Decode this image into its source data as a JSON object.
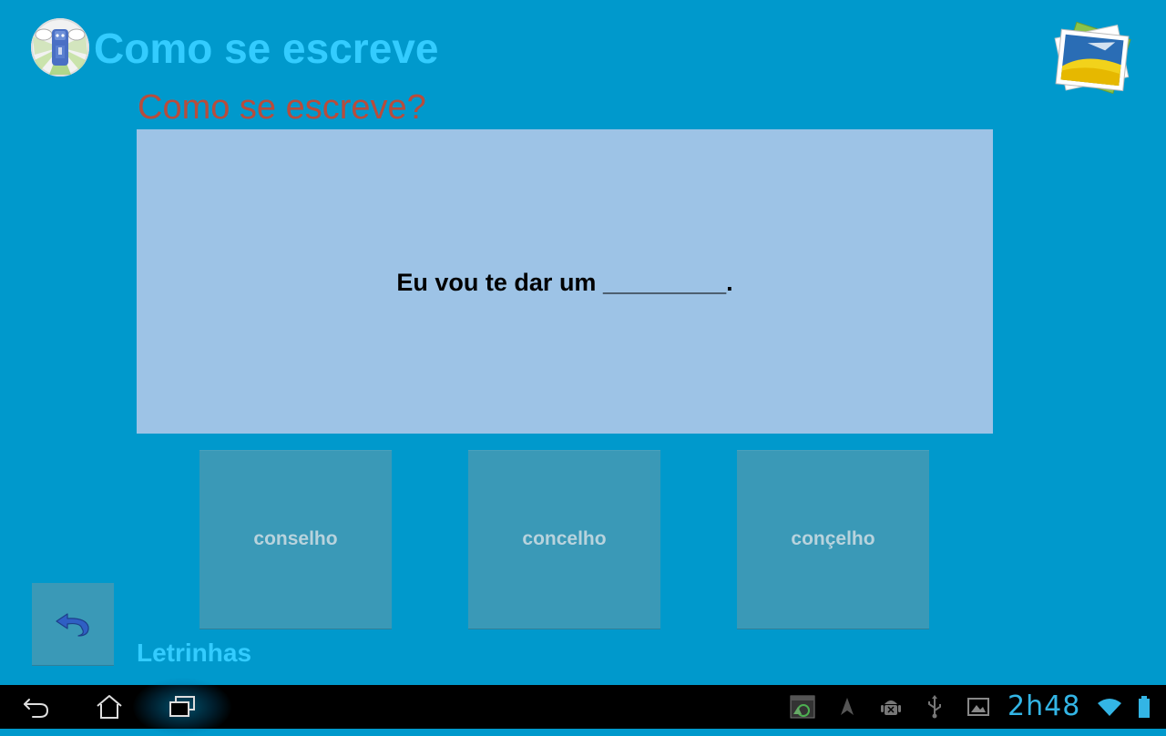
{
  "header": {
    "app_title": "Como se escreve",
    "logo_icon": "mascot-logo-icon",
    "action_icon": "photo-gallery-icon"
  },
  "question": {
    "heading": "Como se escreve?",
    "sentence": "Eu vou te dar um _________."
  },
  "options": [
    {
      "label": "conselho"
    },
    {
      "label": "concelho"
    },
    {
      "label": "conçelho"
    }
  ],
  "footer": {
    "back_icon": "undo-arrow-icon",
    "label": "Letrinhas"
  },
  "system_bar": {
    "clock": "2h48",
    "nav_icons": [
      "back-icon",
      "home-icon",
      "recent-apps-icon"
    ],
    "status_icons": [
      "screenshot-notification-icon",
      "navigation-arrow-icon",
      "android-debug-icon",
      "usb-icon",
      "gallery-notification-icon",
      "wifi-icon",
      "battery-icon"
    ]
  },
  "colors": {
    "background": "#0099cc",
    "title": "#33ccff",
    "heading": "#b84c3c",
    "panel": "#9dc3e6",
    "button": "#3a99b7",
    "button_text": "#b8d3dd"
  }
}
